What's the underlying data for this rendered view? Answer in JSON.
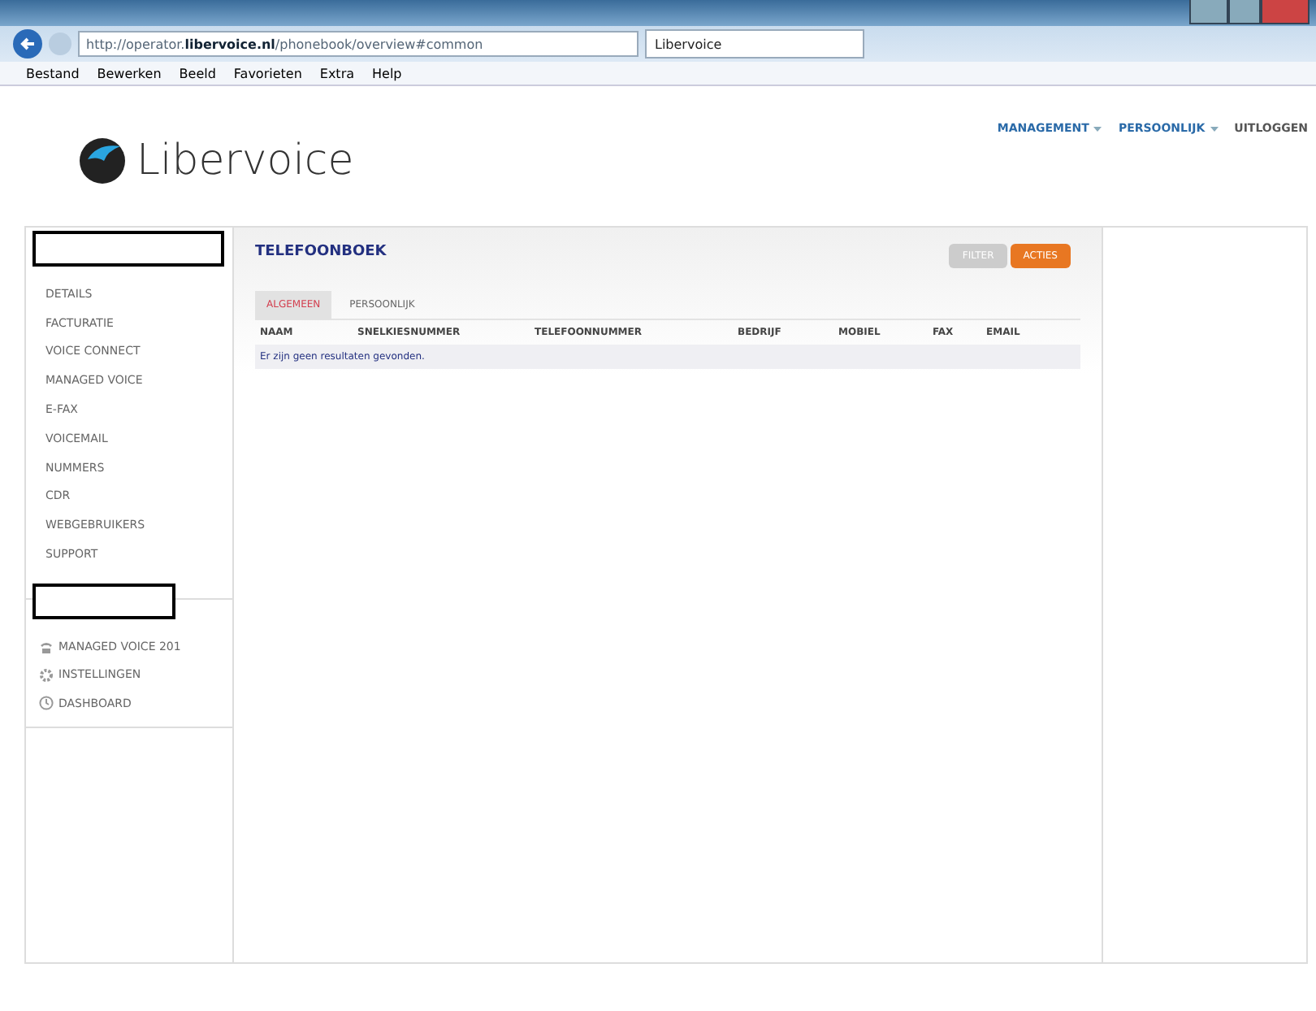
{
  "browser": {
    "url_prefix": "http://operator.",
    "url_domain": "libervoice.nl",
    "url_path": "/phonebook/overview#common",
    "tab_title": "Libervoice",
    "menu": [
      "Bestand",
      "Bewerken",
      "Beeld",
      "Favorieten",
      "Extra",
      "Help"
    ]
  },
  "logo": {
    "text": "Libervoice"
  },
  "top_nav": [
    {
      "label": "MANAGEMENT",
      "dropdown": true
    },
    {
      "label": "PERSOONLIJK",
      "dropdown": true
    },
    {
      "label": "UITLOGGEN",
      "dropdown": false
    }
  ],
  "sidebar": {
    "items": [
      "DETAILS",
      "FACTURATIE",
      "VOICE CONNECT",
      "MANAGED VOICE",
      "E-FAX",
      "VOICEMAIL",
      "NUMMERS",
      "CDR",
      "WEBGEBRUIKERS",
      "SUPPORT"
    ],
    "links": [
      {
        "kind": "phone",
        "label": "MANAGED VOICE 201"
      },
      {
        "kind": "gear",
        "label": "INSTELLINGEN"
      },
      {
        "kind": "clock",
        "label": "DASHBOARD"
      }
    ]
  },
  "content": {
    "title": "TELEFOONBOEK",
    "buttons": [
      {
        "label": "FILTER",
        "disabled": true
      },
      {
        "label": "ACTIES",
        "disabled": false
      }
    ],
    "tabs": [
      {
        "label": "ALGEMEEN",
        "selected": true
      },
      {
        "label": "PERSOONLIJK",
        "selected": false
      }
    ],
    "columns": [
      "NAAM",
      "SNELKIESNUMMER",
      "TELEFOONNUMMER",
      "BEDRIJF",
      "MOBIEL",
      "FAX",
      "EMAIL"
    ],
    "empty_message": "Er zijn geen resultaten gevonden."
  }
}
